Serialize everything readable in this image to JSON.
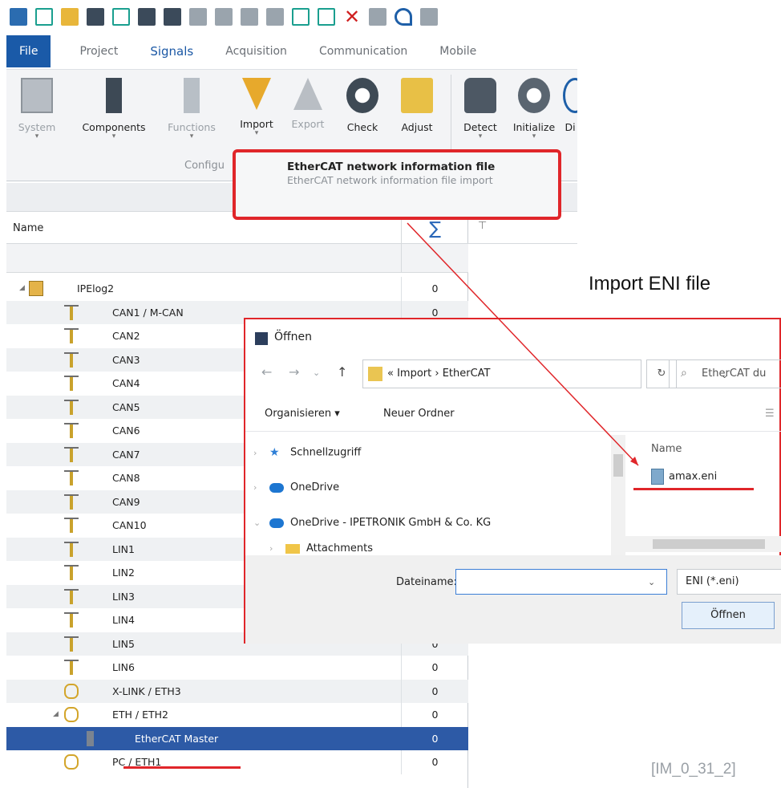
{
  "quick_access": {
    "icons": [
      "app-icon",
      "new-icon",
      "open-icon",
      "save-icon",
      "save-as-icon",
      "config-icon",
      "print-icon",
      "cut-icon",
      "copy-icon",
      "paste-icon",
      "paste-special-icon",
      "add-icon",
      "document-icon",
      "delete-icon",
      "tools-icon",
      "undo-icon",
      "redo-icon"
    ]
  },
  "tabs": {
    "file": "File",
    "project": "Project",
    "signals": "Signals",
    "acquisition": "Acquisition",
    "communication": "Communication",
    "mobile": "Mobile"
  },
  "ribbon": {
    "system": "System",
    "components": "Components",
    "functions": "Functions",
    "import": "Import",
    "export": "Export",
    "check": "Check",
    "adjust": "Adjust",
    "detect": "Detect",
    "initialize": "Initialize",
    "dis": "Di",
    "group_label": "Configu"
  },
  "tooltip": {
    "title": "EtherCAT network information file",
    "description": "EtherCAT network information file import"
  },
  "tree": {
    "col_name": "Name",
    "col_sigma": "∑",
    "rows": [
      {
        "label": "IPElog2",
        "count": "0"
      },
      {
        "label": "CAN1 / M-CAN",
        "count": "0"
      },
      {
        "label": "CAN2",
        "count": ""
      },
      {
        "label": "CAN3",
        "count": ""
      },
      {
        "label": "CAN4",
        "count": ""
      },
      {
        "label": "CAN5",
        "count": ""
      },
      {
        "label": "CAN6",
        "count": ""
      },
      {
        "label": "CAN7",
        "count": ""
      },
      {
        "label": "CAN8",
        "count": ""
      },
      {
        "label": "CAN9",
        "count": ""
      },
      {
        "label": "CAN10",
        "count": ""
      },
      {
        "label": "LIN1",
        "count": ""
      },
      {
        "label": "LIN2",
        "count": ""
      },
      {
        "label": "LIN3",
        "count": ""
      },
      {
        "label": "LIN4",
        "count": ""
      },
      {
        "label": "LIN5",
        "count": "0"
      },
      {
        "label": "LIN6",
        "count": "0"
      },
      {
        "label": "X-LINK / ETH3",
        "count": "0"
      },
      {
        "label": "ETH / ETH2",
        "count": "0"
      },
      {
        "label": "EtherCAT Master",
        "count": "0"
      },
      {
        "label": "PC / ETH1",
        "count": "0"
      }
    ]
  },
  "annotation": "Import ENI file",
  "reference": "[IM_0_31_2]",
  "dialog": {
    "title": "Öffnen",
    "path": "«  Import  ›  EtherCAT",
    "search_placeholder": "EtherCAT du",
    "organize": "Organisieren ▾",
    "new_folder": "Neuer Ordner",
    "nav": {
      "quick": "Schnellzugriff",
      "onedrive": "OneDrive",
      "onedrive_org": "OneDrive - IPETRONIK GmbH & Co. KG",
      "attachments": "Attachments"
    },
    "file_col": "Name",
    "file": "amax.eni",
    "filename_label": "Dateiname:",
    "filename_value": "",
    "filter": "ENI (*.eni)",
    "open_button": "Öffnen"
  },
  "colors": {
    "accent": "#1a5aa8",
    "highlight": "#e0262a",
    "selection": "#2d5aa6"
  }
}
